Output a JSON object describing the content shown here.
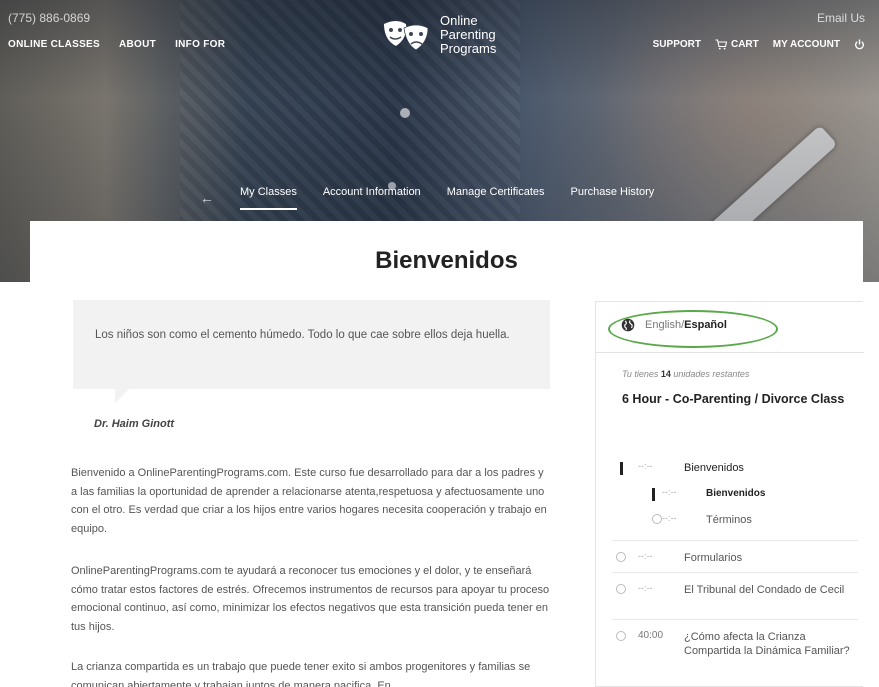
{
  "header": {
    "phone": "(775) 886-0869",
    "email_link": "Email Us",
    "nav_left": [
      "ONLINE CLASSES",
      "ABOUT",
      "INFO FOR"
    ],
    "logo_lines": [
      "Online",
      "Parenting",
      "Programs"
    ],
    "nav_right": {
      "support": "SUPPORT",
      "cart": "CART",
      "account": "MY ACCOUNT"
    }
  },
  "subnav": {
    "items": [
      "My Classes",
      "Account Information",
      "Manage Certificates",
      "Purchase History"
    ],
    "active": "My Classes"
  },
  "main": {
    "title": "Bienvenidos",
    "quote": "Los niños son como el cemento húmedo. Todo lo que cae sobre ellos deja huella.",
    "author": "Dr. Haim Ginott",
    "paragraphs": [
      "Bienvenido a OnlineParentingPrograms.com. Este curso fue desarrollado para dar a los padres y a las familias la oportunidad de aprender a relacionarse atenta,respetuosa y afectuosamente uno con el otro. Es verdad que criar a los hijos entre varios hogares necesita cooperación y trabajo en equipo.",
      "OnlineParentingPrograms.com te ayudará a reconocer tus emociones y el dolor, y te enseñará cómo tratar estos factores de estrés. Ofrecemos instrumentos de recursos para apoyar tu proceso emocional continuo, así como, minimizar los efectos negativos que esta transición pueda tener en tus hijos.",
      "La crianza compartida es un trabajo que puede tener exito si ambos progenitores y familias se comunican abiertamente y trabajan juntos de manera pacifica. En"
    ]
  },
  "sidebar": {
    "lang_english": "English/",
    "lang_spanish": "Español",
    "remaining_prefix": "Tu tienes ",
    "remaining_count": "14",
    "remaining_suffix": " unidades restantes",
    "course_title": "6 Hour - Co-Parenting / Divorce Class",
    "outline": [
      {
        "duration": "--:--",
        "label": "Bienvenidos",
        "level": 0,
        "state": "current"
      },
      {
        "duration": "--:--",
        "label": "Bienvenidos",
        "level": 1,
        "state": "current"
      },
      {
        "duration": "--:--",
        "label": "Términos",
        "level": 1,
        "state": "pending"
      },
      {
        "duration": "--:--",
        "label": "Formularios",
        "level": 0,
        "state": "pending"
      },
      {
        "duration": "--:--",
        "label": "El Tribunal del Condado de Cecil",
        "level": 0,
        "state": "pending"
      },
      {
        "duration": "40:00",
        "label": "¿Cómo afecta la Crianza Compartida la Dinámica Familiar?",
        "level": 0,
        "state": "pending"
      }
    ]
  },
  "colors": {
    "highlight_ring": "#5aa84a",
    "quote_bg": "#f2f2f2"
  },
  "icons": [
    "masks-logo-icon",
    "cart-icon",
    "power-icon",
    "back-arrow-icon",
    "globe-icon",
    "progress-circle-icon"
  ]
}
